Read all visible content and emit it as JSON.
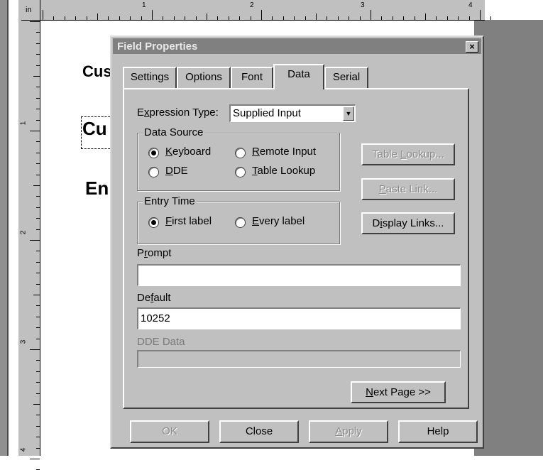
{
  "ruler": {
    "unit": "in",
    "h_labels": [
      "1",
      "2",
      "3",
      "4"
    ],
    "v_labels": [
      "1",
      "2",
      "3",
      "4"
    ]
  },
  "canvas_text": {
    "line1": "Cus",
    "line2": "Cu",
    "line3": "En"
  },
  "dialog": {
    "title": "Field Properties",
    "close_glyph": "×",
    "tabs": [
      {
        "label": "Settings"
      },
      {
        "label": "Options"
      },
      {
        "label": "Font"
      },
      {
        "label": "Data"
      },
      {
        "label": "Serial"
      }
    ],
    "active_tab": "Data",
    "expression_type": {
      "label_pre": "E",
      "label_acc": "x",
      "label_post": "pression Type:",
      "value": "Supplied Input"
    },
    "data_source": {
      "title": "Data Source",
      "options": [
        {
          "acc": "K",
          "rest": "eyboard",
          "selected": true
        },
        {
          "acc": "R",
          "rest": "emote Input",
          "selected": false
        },
        {
          "acc": "D",
          "rest": "DE",
          "selected": false
        },
        {
          "acc": "T",
          "rest": "able Lookup",
          "selected": false
        }
      ]
    },
    "entry_time": {
      "title": "Entry Time",
      "options": [
        {
          "acc": "F",
          "rest": "irst label",
          "selected": true
        },
        {
          "acc": "E",
          "rest": "very label",
          "selected": false
        }
      ]
    },
    "side_buttons": {
      "table_lookup": {
        "pre": "Table ",
        "acc": "L",
        "post": "ookup..."
      },
      "paste_link": {
        "pre": "",
        "acc": "P",
        "post": "aste Link..."
      },
      "display_links": {
        "pre": "D",
        "acc": "i",
        "post": "splay Links..."
      }
    },
    "prompt": {
      "pre": "P",
      "acc": "r",
      "post": "ompt",
      "value": ""
    },
    "default": {
      "pre": "De",
      "acc": "f",
      "post": "ault",
      "value": "10252"
    },
    "dde_data": {
      "label": "DDE Data",
      "value": ""
    },
    "next_page": {
      "acc": "N",
      "post": "ext Page >>"
    },
    "bottom_buttons": {
      "ok": "OK",
      "close": "Close",
      "apply": {
        "acc": "A",
        "post": "pply"
      },
      "help": "Help"
    }
  }
}
